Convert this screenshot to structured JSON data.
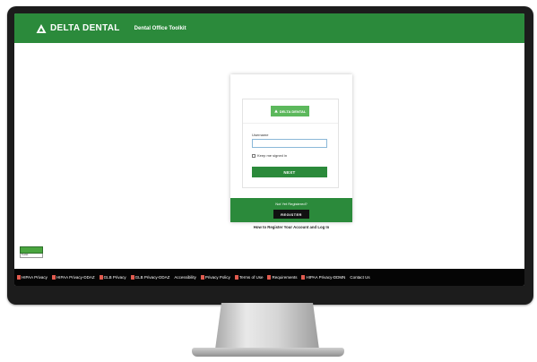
{
  "header": {
    "brand": "DELTA DENTAL",
    "title": "Dental Office Toolkit"
  },
  "login": {
    "logo_text": "DELTA DENTAL",
    "username_label": "Username",
    "username_value": "",
    "keep_signed_in": "Keep me signed in",
    "next": "NEXT",
    "not_registered": "Not Yet Registered?",
    "register": "REGISTER",
    "help_link": "How to Register Your Account and Log In"
  },
  "badge": {
    "text": "Toolkit"
  },
  "footer": {
    "links": [
      {
        "label": "HIPAA Privacy",
        "icon": "pdf-icon"
      },
      {
        "label": "HIPAA Privacy-DDAZ",
        "icon": "pdf-icon"
      },
      {
        "label": "GLB Privacy",
        "icon": "pdf-icon"
      },
      {
        "label": "GLB Privacy-DDAZ",
        "icon": "pdf-icon"
      },
      {
        "label": "Accessibility",
        "icon": ""
      },
      {
        "label": "Privacy Policy",
        "icon": "pdf-icon"
      },
      {
        "label": "Terms of Use",
        "icon": "pdf-icon"
      },
      {
        "label": "Requirements",
        "icon": "pdf-icon"
      },
      {
        "label": "HIPAA Privacy-DDMN",
        "icon": "pdf-icon"
      },
      {
        "label": "Contact Us",
        "icon": ""
      }
    ]
  },
  "colors": {
    "brand_green": "#2b8a3b",
    "logo_green": "#5cb85c",
    "footer_bg": "#050505",
    "bezel": "#1c1c1c"
  }
}
